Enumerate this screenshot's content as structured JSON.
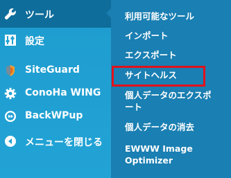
{
  "sidebar": {
    "items": [
      {
        "label": "ツール",
        "icon": "wrench-icon"
      },
      {
        "label": "設定",
        "icon": "settings-sliders-icon"
      },
      {
        "label": "SiteGuard",
        "icon": "siteguard-shield-icon"
      },
      {
        "label": "ConoHa WING",
        "icon": "gear-icon"
      },
      {
        "label": "BackWPup",
        "icon": "backwpup-logo-icon"
      },
      {
        "label": "メニューを閉じる",
        "icon": "collapse-menu-icon"
      }
    ]
  },
  "submenu": {
    "items": [
      {
        "label": "利用可能なツール"
      },
      {
        "label": "インポート"
      },
      {
        "label": "エクスポート"
      },
      {
        "label": "サイトヘルス"
      },
      {
        "label_line1": "個人データのエクスポ",
        "label_line2": "ート"
      },
      {
        "label": "個人データの消去"
      },
      {
        "label_line1": "EWWW Image",
        "label_line2": "Optimizer"
      }
    ]
  },
  "colors": {
    "sidebar_bg": "#21a0d3",
    "active_item_bg": "#0f6d9b",
    "submenu_bg": "#1a7fb2",
    "highlight_border": "#e3111b",
    "text": "#ffffff"
  }
}
